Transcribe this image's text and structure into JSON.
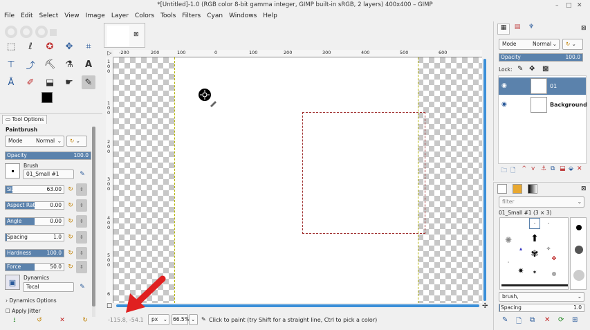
{
  "window": {
    "title": "*[Untitled]-1.0 (RGB color 8-bit gamma integer, GIMP built-in sRGB, 2 layers) 400x400 – GIMP",
    "minimize": "–",
    "maximize": "□",
    "close": "✕"
  },
  "menu": [
    "File",
    "Edit",
    "Select",
    "View",
    "Image",
    "Layer",
    "Colors",
    "Tools",
    "Filters",
    "Cyan",
    "Windows",
    "Help"
  ],
  "tool_options": {
    "tab_label": "Tool Options",
    "tool_name": "Paintbrush",
    "mode_label": "Mode",
    "mode_value": "Normal",
    "opacity": {
      "label": "Opacity",
      "value": "100.0"
    },
    "brush_label": "Brush",
    "brush_value": "01_Small #1",
    "size": {
      "label": "Size",
      "value": "63.00"
    },
    "aspect_ratio": {
      "label": "Aspect Ratio",
      "value": "0.00"
    },
    "angle": {
      "label": "Angle",
      "value": "0.00"
    },
    "spacing": {
      "label": "Spacing",
      "value": "1.0"
    },
    "hardness": {
      "label": "Hardness",
      "value": "100.0"
    },
    "force": {
      "label": "Force",
      "value": "50.0"
    },
    "dynamics_label": "Dynamics",
    "dynamics_value": "Tocal",
    "dynamics_options": "Dynamics Options",
    "apply_jitter": "Apply Jitter"
  },
  "rulers": {
    "h_ticks": [
      "-200",
      "200",
      "100",
      "0",
      "100",
      "200",
      "300",
      "400",
      "500",
      "600"
    ],
    "v_ticks": [
      "1",
      "0",
      "0",
      "1",
      "0",
      "0",
      "2",
      "0",
      "0",
      "3",
      "0",
      "0",
      "4",
      "0",
      "0",
      "5",
      "0",
      "0",
      "6"
    ]
  },
  "status": {
    "coords": "-115.8, -54.1",
    "unit": "px",
    "zoom": "66.5%",
    "message": "Click to paint (try Shift for a straight line, Ctrl to pick a color)"
  },
  "layers": {
    "mode_label": "Mode",
    "mode_value": "Normal",
    "opacity": {
      "label": "Opacity",
      "value": "100.0"
    },
    "lock_label": "Lock:",
    "items": [
      {
        "name": "01",
        "selected": true
      },
      {
        "name": "Background",
        "selected": false
      }
    ]
  },
  "brushes": {
    "filter_placeholder": "filter",
    "selected_name": "01_Small #1 (3 × 3)",
    "tag_value": "brush,",
    "spacing": {
      "label": "Spacing",
      "value": "1.0"
    }
  },
  "colors": {
    "accent": "#5b82ac",
    "scroll": "#3b8fd8",
    "arrow": "#e02020"
  }
}
